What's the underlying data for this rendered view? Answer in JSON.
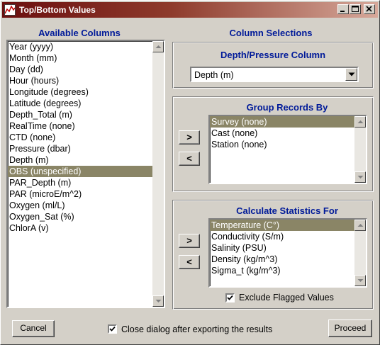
{
  "window": {
    "title": "Top/Bottom Values",
    "controls": {
      "minimize": "_",
      "maximize": "□",
      "close": "✕"
    }
  },
  "available_columns": {
    "header": "Available Columns",
    "items": [
      "Year (yyyy)",
      "Month (mm)",
      "Day (dd)",
      "Hour (hours)",
      "Longitude (degrees)",
      "Latitude (degrees)",
      "Depth_Total (m)",
      "RealTime (none)",
      "CTD (none)",
      "Pressure (dbar)",
      "Depth (m)",
      "OBS (unspecified)",
      "PAR_Depth (m)",
      "PAR (microE/m^2)",
      "Oxygen (ml/L)",
      "Oxygen_Sat (%)",
      "ChlorA (v)"
    ],
    "selected_index": 11
  },
  "column_selections": {
    "header": "Column Selections",
    "depth": {
      "header": "Depth/Pressure Column",
      "value": "Depth (m)"
    },
    "group": {
      "header": "Group Records By",
      "items": [
        "Survey (none)",
        "Cast (none)",
        "Station (none)"
      ],
      "selected_index": 0,
      "add_label": ">",
      "remove_label": "<"
    },
    "stats": {
      "header": "Calculate Statistics For",
      "items": [
        "Temperature (C°)",
        "Conductivity (S/m)",
        "Salinity (PSU)",
        "Density  (kg/m^3)",
        "Sigma_t  (kg/m^3)"
      ],
      "selected_index": 0,
      "add_label": ">",
      "remove_label": "<",
      "exclude_flagged": {
        "label": "Exclude Flagged Values",
        "checked": true
      }
    }
  },
  "footer": {
    "cancel_label": "Cancel",
    "close_after_export": {
      "label": "Close dialog after exporting the results",
      "checked": true
    },
    "proceed_label": "Proceed"
  }
}
